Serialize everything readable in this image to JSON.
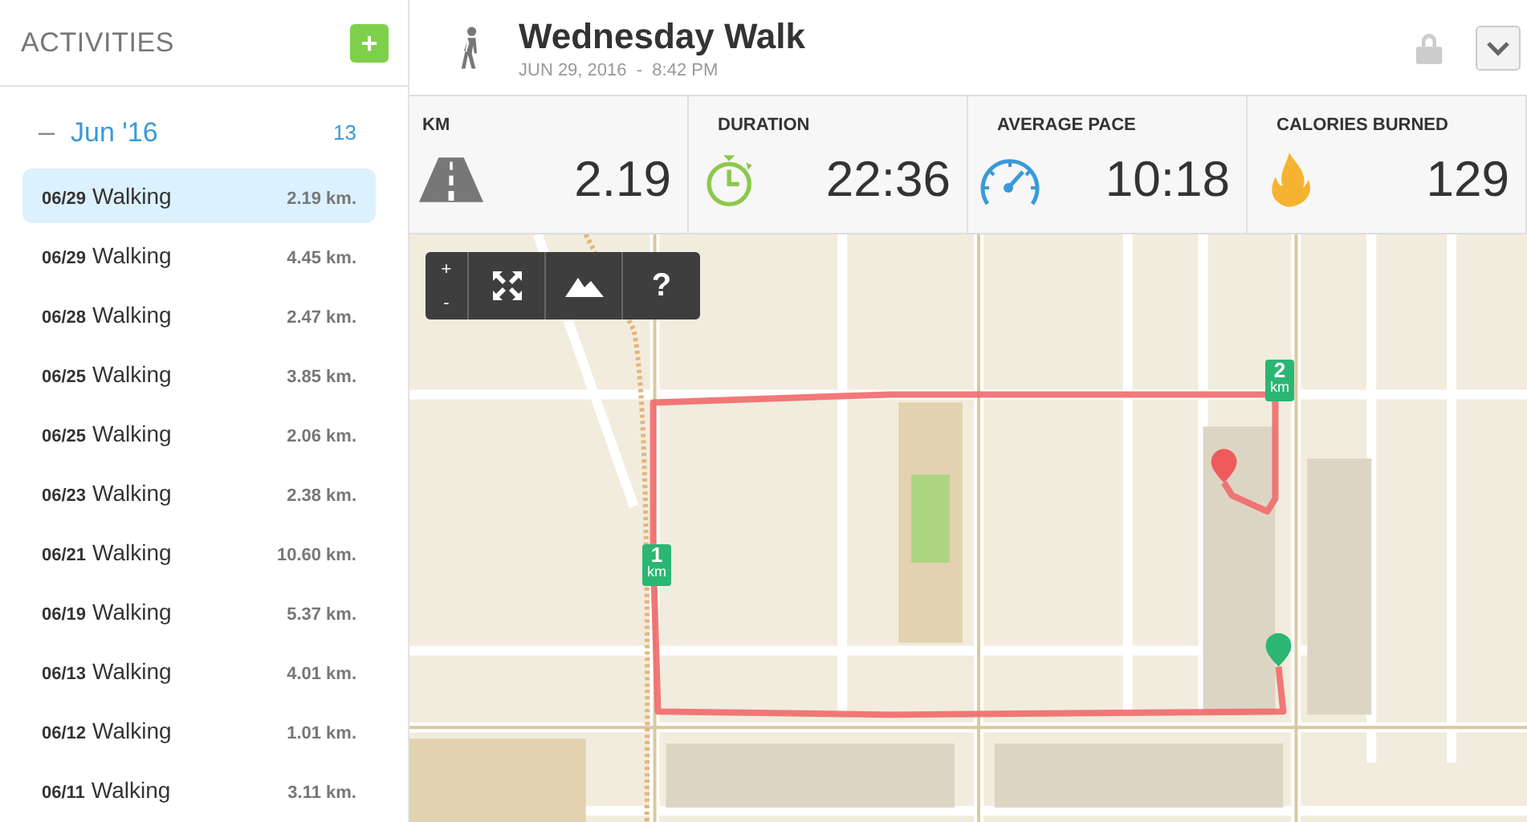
{
  "sidebar": {
    "title": "ACTIVITIES",
    "add_button": "+",
    "group": {
      "collapse": "–",
      "label": "Jun '16",
      "count": "13",
      "expanded": true
    },
    "items": [
      {
        "date": "06/29",
        "type": "Walking",
        "distance": "2.19 km.",
        "selected": true
      },
      {
        "date": "06/29",
        "type": "Walking",
        "distance": "4.45 km.",
        "selected": false
      },
      {
        "date": "06/28",
        "type": "Walking",
        "distance": "2.47 km.",
        "selected": false
      },
      {
        "date": "06/25",
        "type": "Walking",
        "distance": "3.85 km.",
        "selected": false
      },
      {
        "date": "06/25",
        "type": "Walking",
        "distance": "2.06 km.",
        "selected": false
      },
      {
        "date": "06/23",
        "type": "Walking",
        "distance": "2.38 km.",
        "selected": false
      },
      {
        "date": "06/21",
        "type": "Walking",
        "distance": "10.60 km.",
        "selected": false
      },
      {
        "date": "06/19",
        "type": "Walking",
        "distance": "5.37 km.",
        "selected": false
      },
      {
        "date": "06/13",
        "type": "Walking",
        "distance": "4.01 km.",
        "selected": false
      },
      {
        "date": "06/12",
        "type": "Walking",
        "distance": "1.01 km.",
        "selected": false
      },
      {
        "date": "06/11",
        "type": "Walking",
        "distance": "3.11 km.",
        "selected": false
      }
    ]
  },
  "header": {
    "title": "Wednesday Walk",
    "subtitle": "JUN 29, 2016  -  8:42 PM",
    "locked": true
  },
  "stats": [
    {
      "kind": "road",
      "label": "KM",
      "value": "2.19"
    },
    {
      "kind": "stopwatch",
      "label": "DURATION",
      "value": "22:36"
    },
    {
      "kind": "gauge",
      "label": "AVERAGE PACE",
      "value": "10:18"
    },
    {
      "kind": "flame",
      "label": "CALORIES BURNED",
      "value": "129"
    }
  ],
  "map": {
    "controls": {
      "zoom_in": "+",
      "zoom_out": "-",
      "help": "?"
    },
    "markers": [
      {
        "number": "1",
        "unit": "km"
      },
      {
        "number": "2",
        "unit": "km"
      }
    ]
  }
}
